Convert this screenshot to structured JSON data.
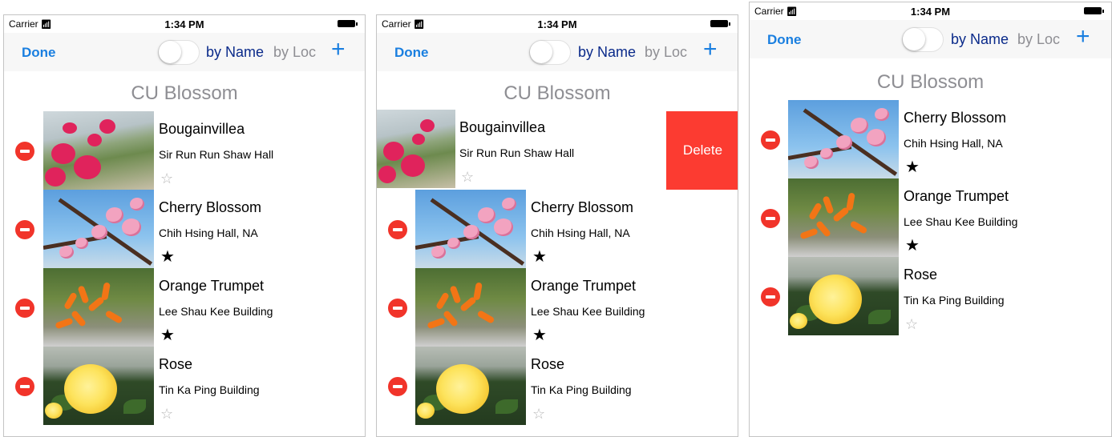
{
  "status": {
    "carrier": "Carrier",
    "wifi_icon": "wifi-icon",
    "time": "1:34 PM",
    "battery_icon": "battery-icon"
  },
  "nav": {
    "done": "Done",
    "sort_name": "by Name",
    "sort_loc": "by Loc",
    "add": "+"
  },
  "title": "CU Blossom",
  "delete_label": "Delete",
  "flowers": {
    "bougainvillea": {
      "name": "Bougainvillea",
      "location": "Sir Run Run Shaw Hall",
      "favorite": "☆"
    },
    "cherry": {
      "name": "Cherry Blossom",
      "location": "Chih Hsing Hall, NA",
      "favorite": "★"
    },
    "orange": {
      "name": "Orange Trumpet",
      "location": "Lee Shau Kee Building",
      "favorite": "★"
    },
    "rose": {
      "name": "Rose",
      "location": "Tin Ka Ping Building",
      "favorite": "☆"
    }
  },
  "colors": {
    "tint": "#1a7fe0",
    "delete": "#fc3b31",
    "delete_dot": "#f1342a",
    "title_gray": "#8e8e93",
    "nav_bg": "#f7f7f7"
  }
}
